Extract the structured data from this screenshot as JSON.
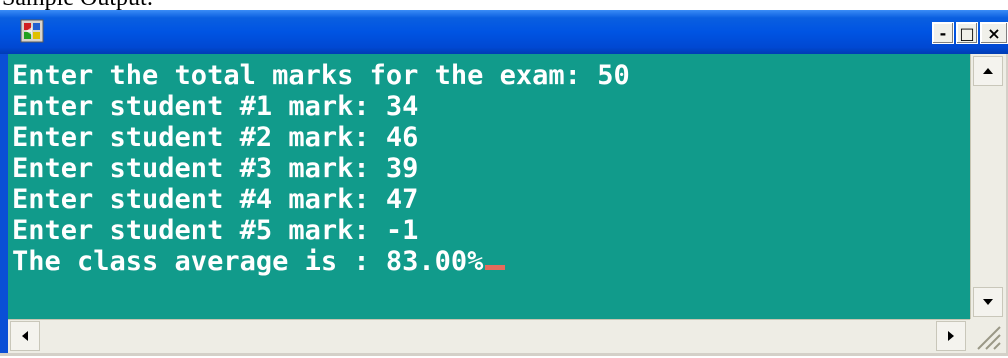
{
  "caption": "Sample Output:",
  "window": {
    "buttons": {
      "minimize": "-",
      "maximize": "□",
      "close": "×"
    }
  },
  "console": {
    "lines": [
      "Enter the total marks for the exam: 50",
      "Enter student #1 mark: 34",
      "Enter student #2 mark: 46",
      "Enter student #3 mark: 39",
      "Enter student #4 mark: 47",
      "Enter student #5 mark: -1",
      "The class average is : 83.00%"
    ],
    "colors": {
      "background": "#119b8b",
      "text": "#ffffff",
      "cursor": "#e46b5c"
    }
  }
}
